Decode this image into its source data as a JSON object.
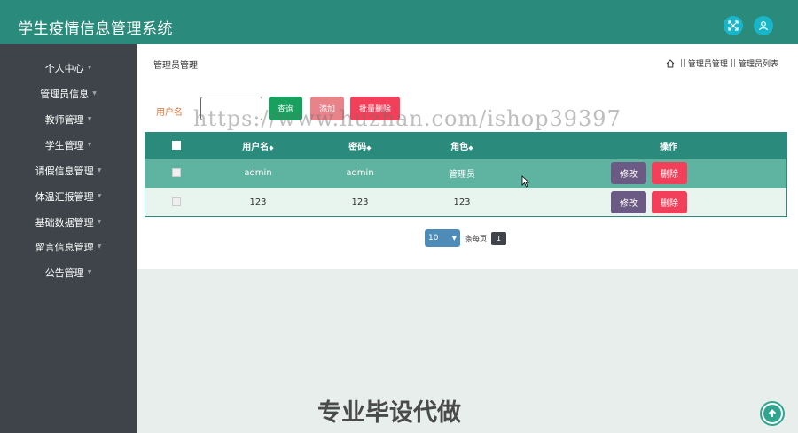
{
  "app": {
    "title": "学生疫情信息管理系统"
  },
  "header": {
    "fullscreen_icon": "fullscreen-icon",
    "user_icon": "user-icon"
  },
  "sidebar": {
    "items": [
      {
        "label": "个人中心"
      },
      {
        "label": "管理员信息"
      },
      {
        "label": "教师管理"
      },
      {
        "label": "学生管理"
      },
      {
        "label": "请假信息管理"
      },
      {
        "label": "体温汇报管理"
      },
      {
        "label": "基础数据管理"
      },
      {
        "label": "留言信息管理"
      },
      {
        "label": "公告管理"
      }
    ]
  },
  "main": {
    "title": "管理员管理",
    "breadcrumb": {
      "level1": "管理员管理",
      "level2": "管理员列表"
    },
    "search": {
      "label": "用户名",
      "value": ""
    },
    "buttons": {
      "query": "查询",
      "add": "添加",
      "batch_delete": "批量删除"
    },
    "table": {
      "columns": {
        "username": "用户名",
        "password": "密码",
        "role": "角色",
        "actions": "操作"
      },
      "rows": [
        {
          "username": "admin",
          "password": "admin",
          "role": "管理员"
        },
        {
          "username": "123",
          "password": "123",
          "role": "123"
        }
      ],
      "edit_label": "修改",
      "delete_label": "删除"
    },
    "pagination": {
      "page_size": "10",
      "per_page_label": "条每页",
      "current_page": "1"
    }
  },
  "overlay": {
    "watermark": "https://www.huzhan.com/ishop39397",
    "promo": "专业毕设代做"
  },
  "colors": {
    "header": "#2a8a7b",
    "sidebar": "#3e4449",
    "danger": "#f3405a",
    "primary": "#17a05e"
  }
}
